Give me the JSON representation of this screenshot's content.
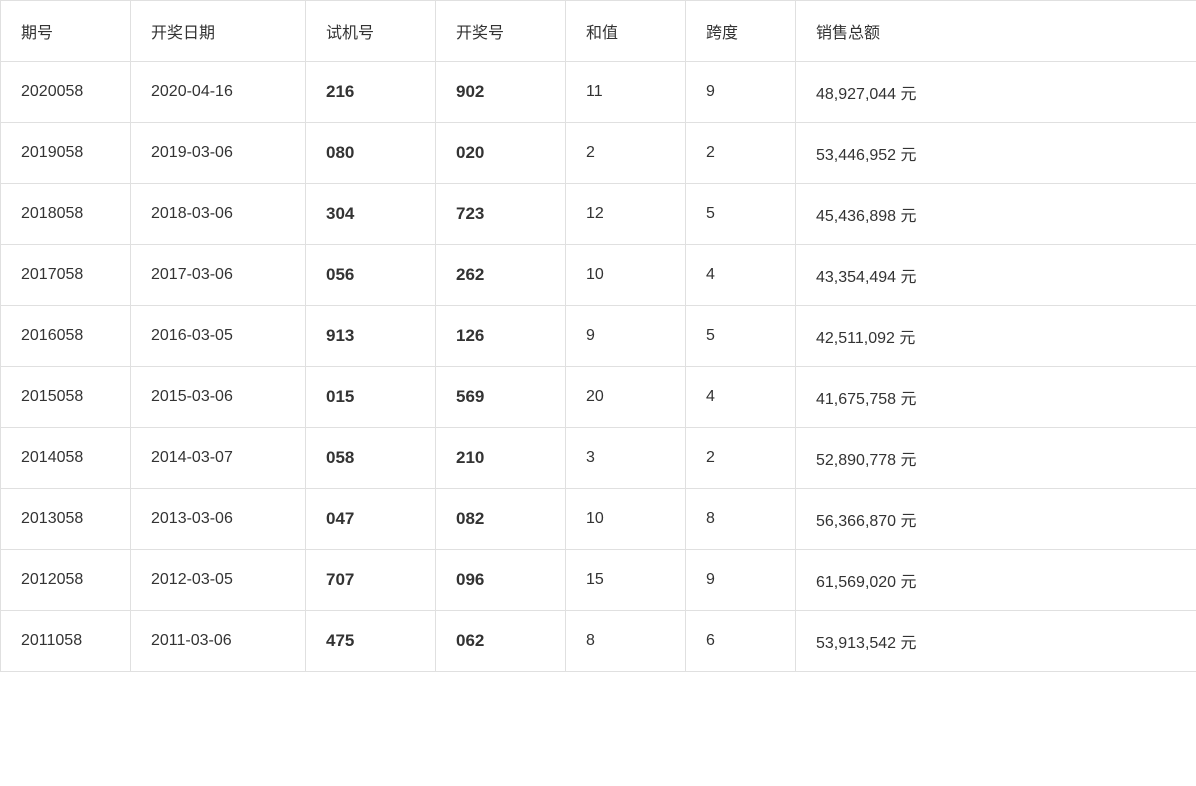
{
  "table": {
    "headers": [
      "期号",
      "开奖日期",
      "试机号",
      "开奖号",
      "和值",
      "跨度",
      "销售总额"
    ],
    "rows": [
      {
        "period": "2020058",
        "date": "2020-04-16",
        "trial": "216",
        "winning": "902",
        "sum": "11",
        "span": "9",
        "sales": "48,927,044 元"
      },
      {
        "period": "2019058",
        "date": "2019-03-06",
        "trial": "080",
        "winning": "020",
        "sum": "2",
        "span": "2",
        "sales": "53,446,952 元"
      },
      {
        "period": "2018058",
        "date": "2018-03-06",
        "trial": "304",
        "winning": "723",
        "sum": "12",
        "span": "5",
        "sales": "45,436,898 元"
      },
      {
        "period": "2017058",
        "date": "2017-03-06",
        "trial": "056",
        "winning": "262",
        "sum": "10",
        "span": "4",
        "sales": "43,354,494 元"
      },
      {
        "period": "2016058",
        "date": "2016-03-05",
        "trial": "913",
        "winning": "126",
        "sum": "9",
        "span": "5",
        "sales": "42,511,092 元"
      },
      {
        "period": "2015058",
        "date": "2015-03-06",
        "trial": "015",
        "winning": "569",
        "sum": "20",
        "span": "4",
        "sales": "41,675,758 元"
      },
      {
        "period": "2014058",
        "date": "2014-03-07",
        "trial": "058",
        "winning": "210",
        "sum": "3",
        "span": "2",
        "sales": "52,890,778 元"
      },
      {
        "period": "2013058",
        "date": "2013-03-06",
        "trial": "047",
        "winning": "082",
        "sum": "10",
        "span": "8",
        "sales": "56,366,870 元"
      },
      {
        "period": "2012058",
        "date": "2012-03-05",
        "trial": "707",
        "winning": "096",
        "sum": "15",
        "span": "9",
        "sales": "61,569,020 元"
      },
      {
        "period": "2011058",
        "date": "2011-03-06",
        "trial": "475",
        "winning": "062",
        "sum": "8",
        "span": "6",
        "sales": "53,913,542 元"
      }
    ]
  }
}
